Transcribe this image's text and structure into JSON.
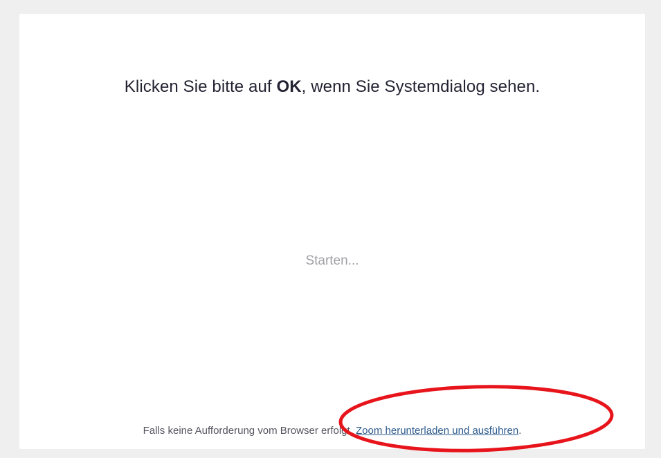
{
  "headline": {
    "before": "Klicken Sie bitte auf ",
    "bold": "OK",
    "after": ", wenn Sie Systemdialog sehen."
  },
  "status": {
    "text": "Starten..."
  },
  "footer": {
    "prefix": "Falls keine Aufforderung vom Browser erfolgt, ",
    "link": "Zoom herunterladen und ausführen",
    "suffix": "."
  },
  "colors": {
    "page_background": "#efefef",
    "card_background": "#ffffff",
    "link": "#2d5a8c",
    "annotation_ring": "#e8141b"
  }
}
